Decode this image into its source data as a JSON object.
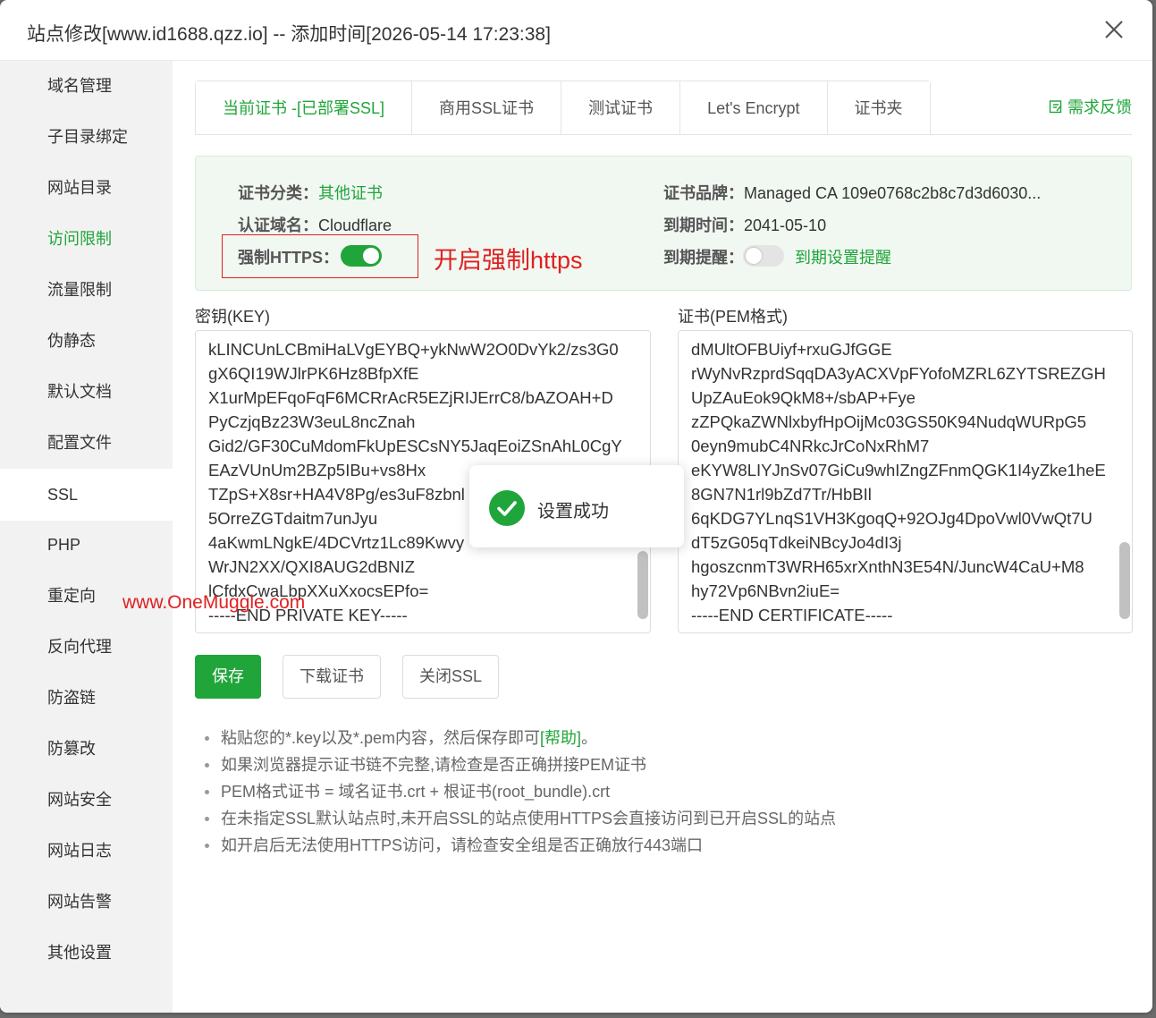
{
  "dialog": {
    "title": "站点修改[www.id1688.qzz.io] -- 添加时间[2026-05-14 17:23:38]"
  },
  "sidebar": {
    "items": [
      {
        "label": "域名管理"
      },
      {
        "label": "子目录绑定"
      },
      {
        "label": "网站目录"
      },
      {
        "label": "访问限制"
      },
      {
        "label": "流量限制"
      },
      {
        "label": "伪静态"
      },
      {
        "label": "默认文档"
      },
      {
        "label": "配置文件"
      },
      {
        "label": "SSL"
      },
      {
        "label": "PHP"
      },
      {
        "label": "重定向"
      },
      {
        "label": "反向代理"
      },
      {
        "label": "防盗链"
      },
      {
        "label": "防篡改"
      },
      {
        "label": "网站安全"
      },
      {
        "label": "网站日志"
      },
      {
        "label": "网站告警"
      },
      {
        "label": "其他设置"
      }
    ],
    "active": "SSL",
    "highlighted": "访问限制"
  },
  "tabs": [
    {
      "label": "当前证书 -[已部署SSL]"
    },
    {
      "label": "商用SSL证书"
    },
    {
      "label": "测试证书"
    },
    {
      "label": "Let's Encrypt"
    },
    {
      "label": "证书夹"
    }
  ],
  "feedback": {
    "label": "需求反馈",
    "icon": "edit-icon"
  },
  "cert_info": {
    "category_label": "证书分类：",
    "category_value": "其他证书",
    "domain_label": "认证域名：",
    "domain_value": "Cloudflare",
    "https_label": "强制HTTPS：",
    "https_enabled": true,
    "brand_label": "证书品牌：",
    "brand_value": "Managed CA 109e0768c2b8c7d3d6030...",
    "expire_label": "到期时间：",
    "expire_value": "2041-05-10",
    "remind_label": "到期提醒：",
    "remind_enabled": false,
    "remind_link": "到期设置提醒"
  },
  "annotation": {
    "text": "开启强制https",
    "color": "#e02020"
  },
  "key_field": {
    "label": "密钥(KEY)",
    "lines": [
      "kLINCUnLCBmiHaLVgEYBQ+ykNwW2O0DvYk2/zs3G0",
      "gX6QI19WJlrPK6Hz8BfpXfE",
      "X1urMpEFqoFqF6MCRrAcR5EZjRIJErrC8/bAZOAH+D",
      "PyCzjqBz23W3euL8ncZnah",
      "Gid2/GF30CuMdomFkUpESCsNY5JaqEoiZSnAhL0CgY",
      "EAzVUnUm2BZp5IBu+vs8Hx",
      "TZpS+X8sr+HA4V8Pg/es3uF8zbnl",
      "5OrreZGTdaitm7unJyu",
      "4aKwmLNgkE/4DCVrtz1Lc89Kwvy",
      "WrJN2XX/QXI8AUG2dBNIZ",
      "lCfdxCwaLbpXXuXxocsEPfo=",
      "-----END PRIVATE KEY-----"
    ]
  },
  "cert_field": {
    "label": "证书(PEM格式)",
    "lines": [
      "dMUltOFBUiyf+rxuGJfGGE",
      "rWyNvRzprdSqqDA3yACXVpFYofoMZRL6ZYTSREZGH",
      "UpZAuEok9QkM8+/sbAP+Fye",
      "zZPQkaZWNlxbyfHpOijMc03GS50K94NudqWURpG5",
      "0eyn9mubC4NRkcJrCoNxRhM7",
      "eKYW8LIYJnSv07GiCu9whIZngZFnmQGK1I4yZke1heE",
      "8GN7N1rl9bZd7Tr/HbBIl",
      "6qKDG7YLnqS1VH3KgoqQ+92OJg4DpoVwl0VwQt7U",
      "dT5zG05qTdkeiNBcyJo4dI3j",
      "hgoszcnmT3WRH65xrXnthN3E54N/JuncW4CaU+M8",
      "hy72Vp6NBvn2iuE=",
      "-----END CERTIFICATE-----"
    ]
  },
  "buttons": {
    "save": "保存",
    "download": "下载证书",
    "close_ssl": "关闭SSL"
  },
  "tips": {
    "t1_pre": "粘贴您的*.key以及*.pem内容，然后保存即可",
    "t1_link": "[帮助]",
    "t1_post": "。",
    "t2": "如果浏览器提示证书链不完整,请检查是否正确拼接PEM证书",
    "t3": "PEM格式证书 = 域名证书.crt + 根证书(root_bundle).crt",
    "t4": "在未指定SSL默认站点时,未开启SSL的站点使用HTTPS会直接访问到已开启SSL的站点",
    "t5": "如开启后无法使用HTTPS访问，请检查安全组是否正确放行443端口"
  },
  "toast": {
    "message": "设置成功",
    "icon": "check-circle-icon"
  },
  "watermark": {
    "text": "www.OneMuggle.com"
  },
  "colors": {
    "accent": "#20a53a",
    "annotation": "#e02020"
  }
}
